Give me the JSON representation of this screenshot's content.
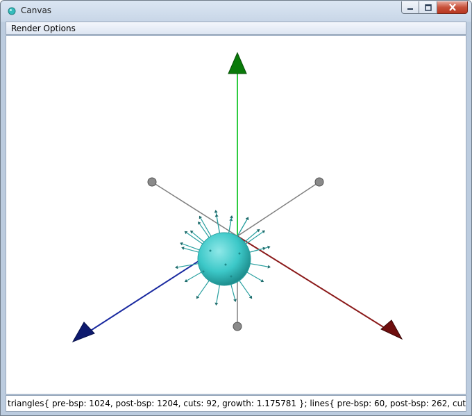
{
  "window": {
    "title": "Canvas"
  },
  "menu": {
    "items": [
      {
        "label": "Render Options"
      }
    ]
  },
  "status": {
    "text": "triangles{ pre-bsp: 1024, post-bsp: 1204, cuts: 92, growth: 1.175781 }; lines{ pre-bsp: 60, post-bsp: 262, cuts 202, growth: ..."
  },
  "scene": {
    "axis_colors": {
      "y": "#0a7a0a",
      "x": "#6e0e0e",
      "z": "#0e1a6e",
      "y_line": "#2ecc40",
      "x_line": "#8b1a1a",
      "z_line": "#1a2aa0"
    },
    "sphere_color": "#3cc8c8",
    "neutral_color": "#808080",
    "arrow_color": "#2aa0a0"
  }
}
